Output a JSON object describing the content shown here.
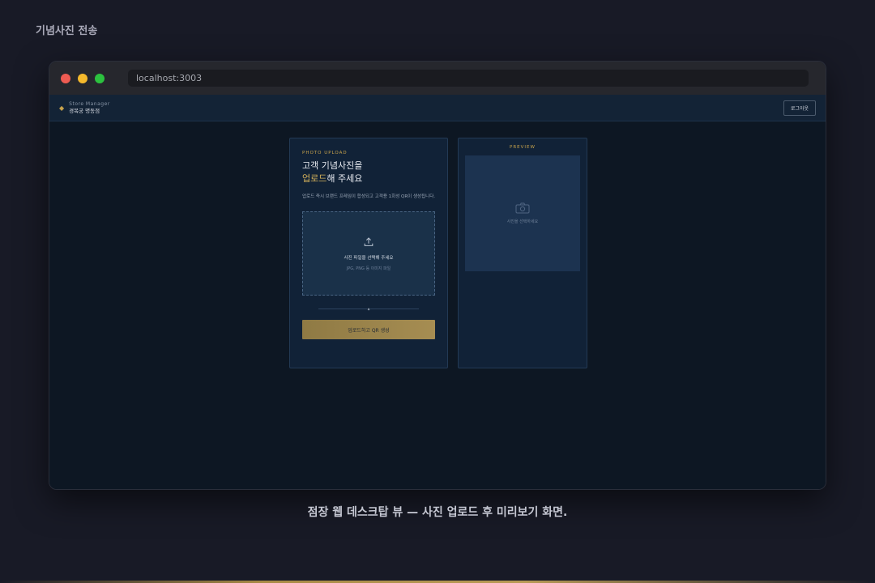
{
  "page": {
    "title": "기념사진 전송",
    "caption": "점장 웹 데스크탑 뷰 — 사진 업로드 후 미리보기 화면."
  },
  "browser": {
    "url": "localhost:3003"
  },
  "app": {
    "brand_sub": "Store Manager",
    "store_name": "경복궁 명동점",
    "logout_label": "로그아웃"
  },
  "upload": {
    "section_label": "PHOTO UPLOAD",
    "heading_line1": "고객 기념사진을",
    "heading_accent": "업로드",
    "heading_rest": "해 주세요",
    "description": "업로드 즉시 브랜드 프레임이 합성되고 고객용 1회성 QR이 생성됩니다.",
    "drop_title": "사진 파일을 선택해 주세요",
    "drop_hint": "JPG, PNG 등 이미지 파일",
    "divider_mark": "◆",
    "submit_label": "업로드하고 QR 생성"
  },
  "preview": {
    "label": "PREVIEW",
    "placeholder": "사진을 선택하세요"
  },
  "colors": {
    "accent_gold": "#c8a34c",
    "panel_bg": "#112237",
    "button_gold": "#a68d52"
  }
}
